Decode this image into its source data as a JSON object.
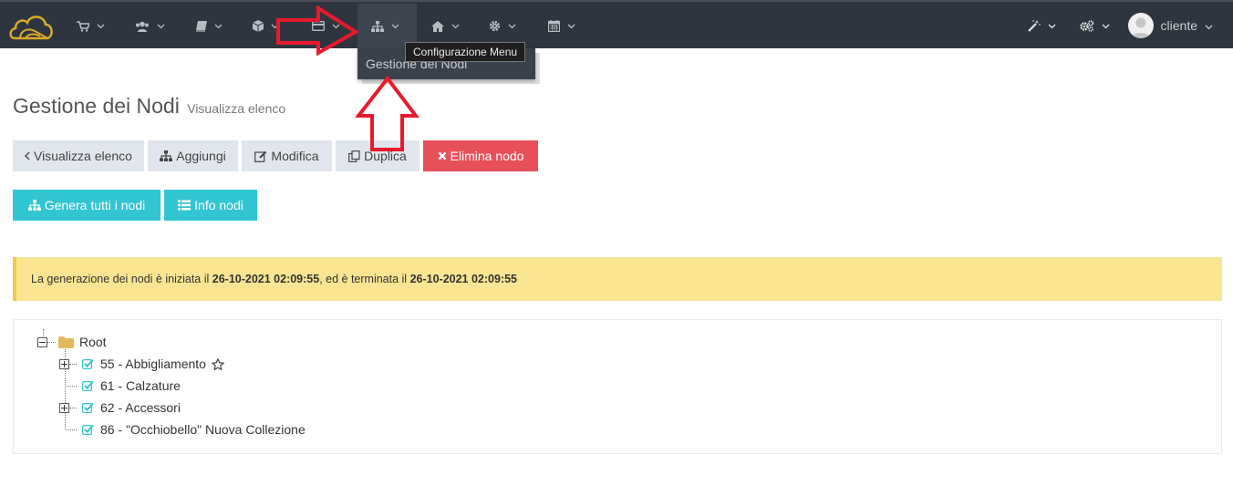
{
  "navbar": {
    "tooltip": "Configurazione Menu",
    "dropdown_item": "Gestione dei Nodi",
    "user_name": "cliente",
    "icons": [
      "logo-cloud-icon",
      "cart-icon",
      "users-icon",
      "book-icon",
      "cube-icon",
      "card-icon",
      "sitemap-icon",
      "home-icon",
      "gear-icon",
      "calendar-icon",
      "magic-wand-icon",
      "gears-icon"
    ]
  },
  "page": {
    "title": "Gestione dei Nodi",
    "subtitle": "Visualizza elenco"
  },
  "actions": {
    "back": "Visualizza elenco",
    "add": "Aggiungi",
    "edit": "Modifica",
    "duplicate": "Duplica",
    "delete": "Elimina nodo",
    "generate": "Genera tutti i nodi",
    "info": "Info nodi"
  },
  "alert": {
    "text_before": "La generazione dei nodi è iniziata il ",
    "start": "26-10-2021 02:09:55",
    "text_middle": ", ed è terminata il ",
    "end": "26-10-2021 02:09:55"
  },
  "tree": {
    "root": "Root",
    "nodes": [
      {
        "label": "55 - Abbigliamento",
        "expandable": true,
        "starred": true
      },
      {
        "label": "61 - Calzature",
        "expandable": false,
        "starred": false
      },
      {
        "label": "62 - Accessori",
        "expandable": true,
        "starred": false
      },
      {
        "label": "86 - \"Occhiobello\" Nuova Collezione",
        "expandable": false,
        "starred": false
      }
    ]
  },
  "colors": {
    "navbar": "#2f353e",
    "danger": "#e7505a",
    "info": "#32c5d2",
    "warning_bg": "#f9e491",
    "annotation_arrow": "#e8192c",
    "logo": "#d8a92a"
  }
}
